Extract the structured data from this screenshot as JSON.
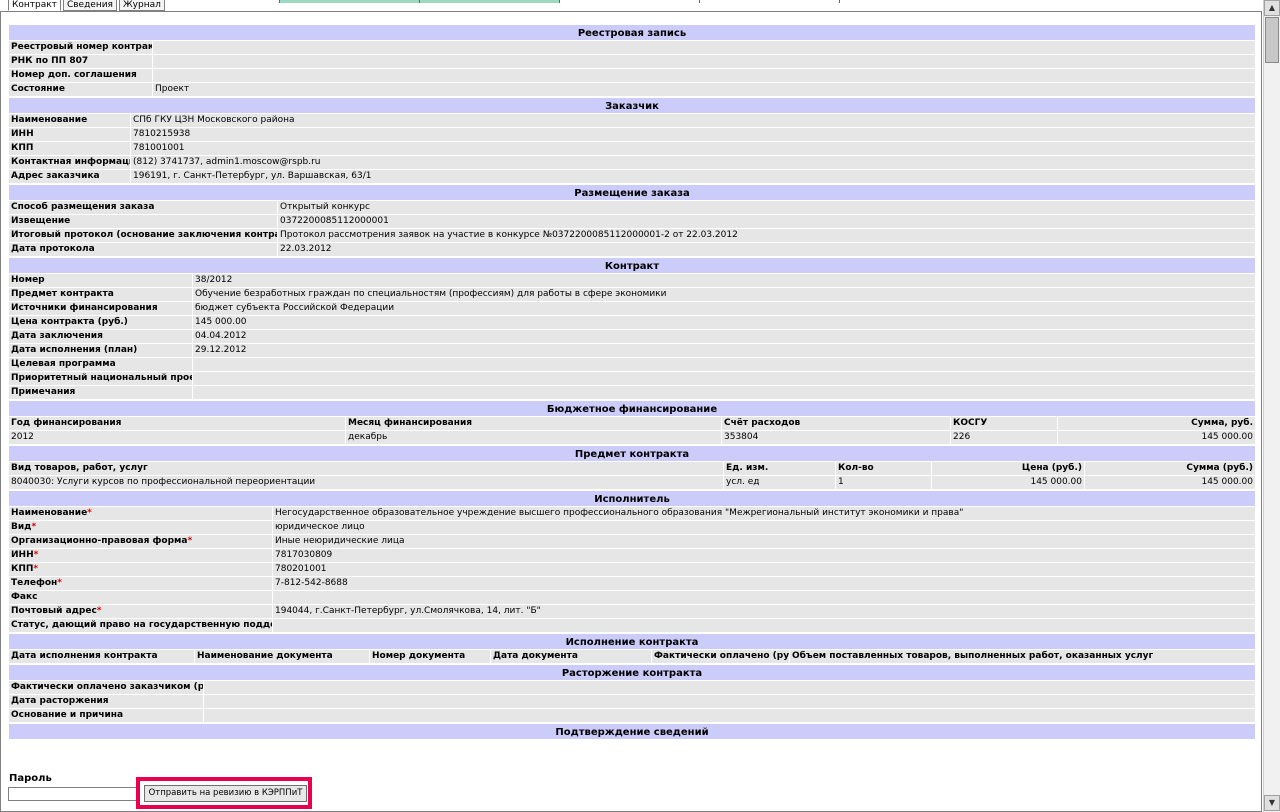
{
  "tabs": [
    "Контракт",
    "Сведения",
    "Журнал"
  ],
  "registry": {
    "title": "Реестровая запись",
    "rows": [
      {
        "label": "Реестровый номер контракта",
        "value": ""
      },
      {
        "label": "РНК по ПП 807",
        "value": ""
      },
      {
        "label": "Номер доп. соглашения",
        "value": ""
      },
      {
        "label": "Состояние",
        "value": "Проект"
      }
    ]
  },
  "customer": {
    "title": "Заказчик",
    "rows": [
      {
        "label": "Наименование",
        "value": "СПб ГКУ ЦЗН Московского района"
      },
      {
        "label": "ИНН",
        "value": "7810215938"
      },
      {
        "label": "КПП",
        "value": "781001001"
      },
      {
        "label": "Контактная информация",
        "value": "(812) 3741737, admin1.moscow@rspb.ru"
      },
      {
        "label": "Адрес заказчика",
        "value": "196191, г. Санкт-Петербург, ул. Варшавская, 63/1"
      }
    ]
  },
  "placement": {
    "title": "Размещение заказа",
    "rows": [
      {
        "label": "Способ размещения заказа",
        "value": "Открытый конкурс"
      },
      {
        "label": "Извещение",
        "value": "0372200085112000001"
      },
      {
        "label": "Итоговый протокол (основание заключения контракта)",
        "value": "Протокол рассмотрения заявок на участие в конкурсе №0372200085112000001-2 от 22.03.2012"
      },
      {
        "label": "Дата протокола",
        "value": "22.03.2012"
      }
    ]
  },
  "contract": {
    "title": "Контракт",
    "rows": [
      {
        "label": "Номер",
        "value": "38/2012"
      },
      {
        "label": "Предмет контракта",
        "value": "Обучение безработных граждан по специальностям (профессиям) для работы в сфере экономики"
      },
      {
        "label": "Источники финансирования",
        "value": "бюджет субъекта Российской Федерации"
      },
      {
        "label": "Цена контракта (руб.)",
        "value": "145 000.00"
      },
      {
        "label": "Дата заключения",
        "value": "04.04.2012"
      },
      {
        "label": "Дата исполнения (план)",
        "value": "29.12.2012"
      },
      {
        "label": "Целевая программа",
        "value": ""
      },
      {
        "label": "Приоритетный национальный проект",
        "value": ""
      },
      {
        "label": "Примечания",
        "value": ""
      }
    ]
  },
  "budget": {
    "title": "Бюджетное финансирование",
    "headers": [
      "Год финансирования",
      "Месяц финансирования",
      "Счёт расходов",
      "КОСГУ",
      "Сумма, руб."
    ],
    "row": [
      "2012",
      "декабрь",
      "353804",
      "226",
      "145 000.00"
    ]
  },
  "subject": {
    "title": "Предмет контракта",
    "headers": [
      "Вид товаров, работ, услуг",
      "Ед. изм.",
      "Кол-во",
      "Цена (руб.)",
      "Сумма (руб.)"
    ],
    "row": [
      "8040030: Услуги курсов по профессиональной переориентации",
      "усл. ед",
      "1",
      "145 000.00",
      "145 000.00"
    ]
  },
  "executor": {
    "title": "Исполнитель",
    "rows": [
      {
        "label": "Наименование",
        "required": true,
        "value": "Негосударственное образовательное учреждение высшего профессионального образования \"Межрегиональный институт экономики и права\""
      },
      {
        "label": "Вид",
        "required": true,
        "value": "юридическое лицо"
      },
      {
        "label": "Организационно-правовая форма",
        "required": true,
        "value": "Иные неюридические лица"
      },
      {
        "label": "ИНН",
        "required": true,
        "value": "7817030809"
      },
      {
        "label": "КПП",
        "required": true,
        "value": "780201001"
      },
      {
        "label": "Телефон",
        "required": true,
        "value": "7-812-542-8688"
      },
      {
        "label": "Факс",
        "required": false,
        "value": ""
      },
      {
        "label": "Почтовый адрес",
        "required": true,
        "value": "194044, г.Санкт-Петербург, ул.Смолячкова, 14, лит. \"Б\""
      },
      {
        "label": "Статус, дающий право на государственную поддержку",
        "required": false,
        "value": ""
      }
    ],
    "required_mark": "*"
  },
  "execution": {
    "title": "Исполнение контракта",
    "headers": [
      "Дата исполнения контракта",
      "Наименование документа",
      "Номер документа",
      "Дата документа",
      "Фактически оплачено (руб.)",
      "Объем поставленных товаров, выполненных работ, оказанных услуг"
    ]
  },
  "termination": {
    "title": "Расторжение контракта",
    "rows": [
      {
        "label": "Фактически оплачено заказчиком (руб.)",
        "value": ""
      },
      {
        "label": "Дата расторжения",
        "value": ""
      },
      {
        "label": "Основание и причина",
        "value": ""
      }
    ]
  },
  "confirmation": {
    "title": "Подтверждение сведений",
    "password_label": "Пароль",
    "password_value": "",
    "send_button": "Отправить на ревизию в КЭРППиТ"
  },
  "scrollbar": {
    "up": "▲",
    "down": "▼"
  }
}
